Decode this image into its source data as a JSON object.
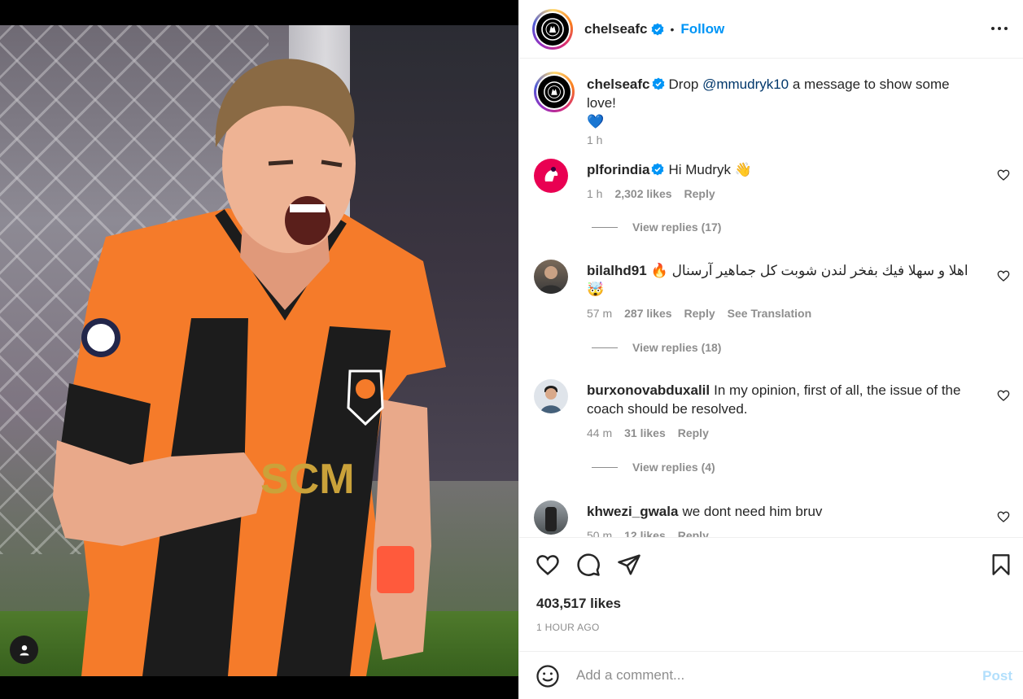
{
  "colors": {
    "accent": "#0095f6",
    "link": "#00376b",
    "text": "#262626",
    "muted": "#8e8e8e",
    "jersey_orange": "#f57b2a",
    "post_disabled": "#b2dffc"
  },
  "post": {
    "author": "chelseafc",
    "follow_label": "Follow",
    "separator": "•",
    "caption": {
      "username": "chelseafc",
      "text_before": "Drop ",
      "mention": "@mmudryk10",
      "text_after": " a message to show some love!",
      "emoji": "💙",
      "time": "1 h"
    },
    "likes": "403,517 likes",
    "time_ago": "1 HOUR AGO"
  },
  "comments": [
    {
      "username": "plforindia",
      "verified": true,
      "text": "Hi Mudryk 👋",
      "time": "1 h",
      "likes": "2,302 likes",
      "reply": "Reply",
      "view_replies": "View replies (17)"
    },
    {
      "username": "bilalhd91",
      "verified": false,
      "text": "اهلا و سهلا فيك بفخر لندن شوبت كل جماهير آرسنال 🔥",
      "text2": "🤯",
      "time": "57 m",
      "likes": "287 likes",
      "reply": "Reply",
      "see_translation": "See Translation",
      "view_replies": "View replies (18)"
    },
    {
      "username": "burxonovabduxalil",
      "verified": false,
      "text": "In my opinion, first of all, the issue of the coach should be resolved.",
      "time": "44 m",
      "likes": "31 likes",
      "reply": "Reply",
      "view_replies": "View replies (4)"
    },
    {
      "username": "khwezi_gwala",
      "verified": false,
      "text": "we dont need him bruv",
      "time": "50 m",
      "likes": "12 likes",
      "reply": "Reply"
    }
  ],
  "composer": {
    "placeholder": "Add a comment...",
    "post_label": "Post"
  },
  "icons": {
    "header_more": "more-horizontal-icon",
    "like": "heart-icon",
    "comment": "comment-bubble-icon",
    "share": "paper-plane-icon",
    "save": "bookmark-icon",
    "emoji": "smiley-icon",
    "user_tag": "user-tag-icon",
    "verified": "verified-badge-icon"
  }
}
